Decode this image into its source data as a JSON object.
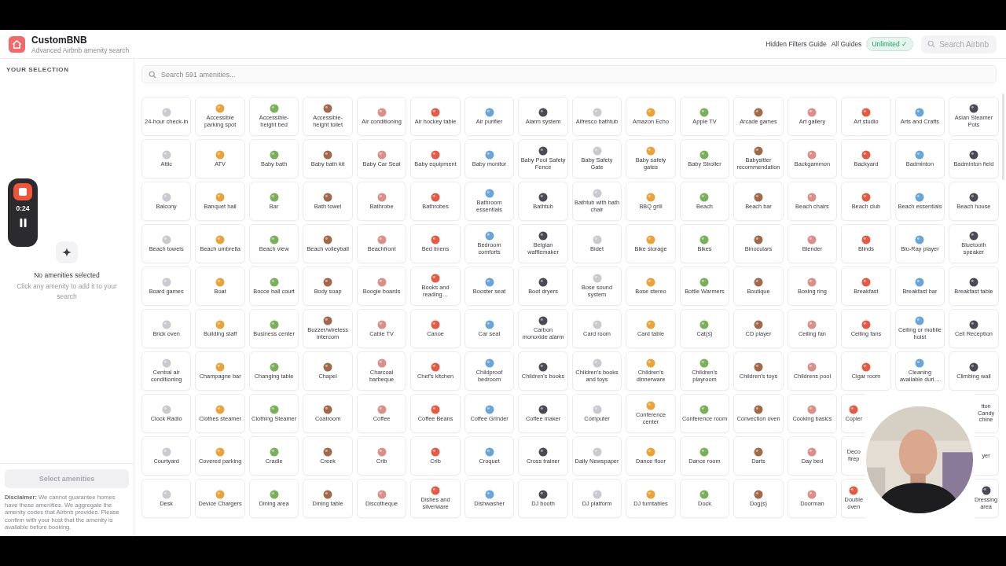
{
  "app": {
    "name": "CustomBNB",
    "tagline": "Advanced Airbnb amenity search"
  },
  "nav": {
    "links": [
      "Hidden Filters Guide",
      "All Guides"
    ],
    "plan_badge": "Unlimited ✓",
    "search_button": "Search Airbnb"
  },
  "sidebar": {
    "heading": "YOUR SELECTION",
    "empty_title": "No amenities selected",
    "empty_hint": "Click any amenity to add it to your search",
    "select_button": {
      "label": "Select amenities",
      "disabled": true
    },
    "disclaimer": "**Disclaimer:** We cannot guarantee homes have these amenities. We aggregate the amenity codes that Airbnb provides. Please confirm with your host that the amenity is available before booking."
  },
  "recorder": {
    "time": "0:24"
  },
  "amenity_search": {
    "placeholder": "Search 591 amenities..."
  },
  "amenities": [
    {
      "label": "24-hour check-in",
      "kind": "full"
    },
    {
      "label": "Accessible parking spot",
      "kind": "full"
    },
    {
      "label": "Accessible-height bed",
      "kind": "full"
    },
    {
      "label": "Accessible-height toilet",
      "kind": "full"
    },
    {
      "label": "Air conditioning",
      "kind": "full"
    },
    {
      "label": "Air hockey table",
      "kind": "full"
    },
    {
      "label": "Air purifier",
      "kind": "full"
    },
    {
      "label": "Alarm system",
      "kind": "full"
    },
    {
      "label": "Alfresco bathtub",
      "kind": "full"
    },
    {
      "label": "Amazon Echo",
      "kind": "full"
    },
    {
      "label": "Apple TV",
      "kind": "full"
    },
    {
      "label": "Arcade games",
      "kind": "full"
    },
    {
      "label": "Art gallery",
      "kind": "full"
    },
    {
      "label": "Art studio",
      "kind": "full"
    },
    {
      "label": "Arts and Crafts",
      "kind": "full"
    },
    {
      "label": "Asian Steamer Pots",
      "kind": "full"
    },
    {
      "label": "Attic",
      "kind": "full"
    },
    {
      "label": "ATV",
      "kind": "full"
    },
    {
      "label": "Baby bath",
      "kind": "full"
    },
    {
      "label": "Baby bath kit",
      "kind": "full"
    },
    {
      "label": "Baby Car Seat",
      "kind": "full"
    },
    {
      "label": "Baby equipment",
      "kind": "full"
    },
    {
      "label": "Baby monitor",
      "kind": "full"
    },
    {
      "label": "Baby Pool Safety Fence",
      "kind": "full"
    },
    {
      "label": "Baby Safety Gate",
      "kind": "full"
    },
    {
      "label": "Baby safety gates",
      "kind": "full"
    },
    {
      "label": "Baby Stroller",
      "kind": "full"
    },
    {
      "label": "Babysitter recommendation",
      "kind": "full"
    },
    {
      "label": "Backgammon",
      "kind": "full"
    },
    {
      "label": "Backyard",
      "kind": "full"
    },
    {
      "label": "Badminton",
      "kind": "full"
    },
    {
      "label": "Badminton field",
      "kind": "full"
    },
    {
      "label": "Balcony",
      "kind": "full"
    },
    {
      "label": "Banquet hall",
      "kind": "full"
    },
    {
      "label": "Bar",
      "kind": "full"
    },
    {
      "label": "Bath towel",
      "kind": "full"
    },
    {
      "label": "Bathrobe",
      "kind": "full"
    },
    {
      "label": "Bathrobes",
      "kind": "full"
    },
    {
      "label": "Bathroom essentials",
      "kind": "full"
    },
    {
      "label": "Bathtub",
      "kind": "full"
    },
    {
      "label": "Bathtub with bath chair",
      "kind": "full"
    },
    {
      "label": "BBQ grill",
      "kind": "full"
    },
    {
      "label": "Beach",
      "kind": "full"
    },
    {
      "label": "Beach bar",
      "kind": "full"
    },
    {
      "label": "Beach chairs",
      "kind": "full"
    },
    {
      "label": "Beach club",
      "kind": "full"
    },
    {
      "label": "Beach essentials",
      "kind": "full"
    },
    {
      "label": "Beach house",
      "kind": "full"
    },
    {
      "label": "Beach towels",
      "kind": "full"
    },
    {
      "label": "Beach umbrella",
      "kind": "full"
    },
    {
      "label": "Beach view",
      "kind": "full"
    },
    {
      "label": "Beach volleyball",
      "kind": "full"
    },
    {
      "label": "Beachfront",
      "kind": "full"
    },
    {
      "label": "Bed linens",
      "kind": "full"
    },
    {
      "label": "Bedroom comforts",
      "kind": "full"
    },
    {
      "label": "Belgian wafflemaker",
      "kind": "full"
    },
    {
      "label": "Bidet",
      "kind": "full"
    },
    {
      "label": "Bike storage",
      "kind": "full"
    },
    {
      "label": "Bikes",
      "kind": "full"
    },
    {
      "label": "Binoculars",
      "kind": "full"
    },
    {
      "label": "Blender",
      "kind": "full"
    },
    {
      "label": "Blinds",
      "kind": "full"
    },
    {
      "label": "Blu-Ray player",
      "kind": "full"
    },
    {
      "label": "Bluetooth speaker",
      "kind": "full"
    },
    {
      "label": "Board games",
      "kind": "full"
    },
    {
      "label": "Boat",
      "kind": "full"
    },
    {
      "label": "Bocce ball court",
      "kind": "full"
    },
    {
      "label": "Body soap",
      "kind": "full"
    },
    {
      "label": "Boogie boards",
      "kind": "full"
    },
    {
      "label": "Books and reading…",
      "kind": "full"
    },
    {
      "label": "Booster seat",
      "kind": "full"
    },
    {
      "label": "Boot dryers",
      "kind": "full"
    },
    {
      "label": "Bose sound system",
      "kind": "full"
    },
    {
      "label": "Bose stereo",
      "kind": "full"
    },
    {
      "label": "Bottle Warmers",
      "kind": "full"
    },
    {
      "label": "Boutique",
      "kind": "full"
    },
    {
      "label": "Boxing ring",
      "kind": "full"
    },
    {
      "label": "Breakfast",
      "kind": "full"
    },
    {
      "label": "Breakfast bar",
      "kind": "full"
    },
    {
      "label": "Breakfast table",
      "kind": "full"
    },
    {
      "label": "Brick oven",
      "kind": "full"
    },
    {
      "label": "Building staff",
      "kind": "full"
    },
    {
      "label": "Business center",
      "kind": "full"
    },
    {
      "label": "Buzzer/wireless intercom",
      "kind": "full"
    },
    {
      "label": "Cable TV",
      "kind": "full"
    },
    {
      "label": "Canoe",
      "kind": "full"
    },
    {
      "label": "Car seat",
      "kind": "full"
    },
    {
      "label": "Carbon monoxide alarm",
      "kind": "full"
    },
    {
      "label": "Card room",
      "kind": "full"
    },
    {
      "label": "Card table",
      "kind": "full"
    },
    {
      "label": "Cat(s)",
      "kind": "full"
    },
    {
      "label": "CD player",
      "kind": "full"
    },
    {
      "label": "Ceiling fan",
      "kind": "full"
    },
    {
      "label": "Ceiling fans",
      "kind": "full"
    },
    {
      "label": "Ceiling or mobile hoist",
      "kind": "full"
    },
    {
      "label": "Cell Reception",
      "kind": "full"
    },
    {
      "label": "Central air conditioning",
      "kind": "full"
    },
    {
      "label": "Champagne bar",
      "kind": "full"
    },
    {
      "label": "Changing table",
      "kind": "full"
    },
    {
      "label": "Chapel",
      "kind": "full"
    },
    {
      "label": "Charcoal barbeque",
      "kind": "full"
    },
    {
      "label": "Chef's kitchen",
      "kind": "full"
    },
    {
      "label": "Childproof bedroom",
      "kind": "full"
    },
    {
      "label": "Children's books",
      "kind": "full"
    },
    {
      "label": "Children's books and toys",
      "kind": "full"
    },
    {
      "label": "Children's dinnerware",
      "kind": "full"
    },
    {
      "label": "Children's playroom",
      "kind": "full"
    },
    {
      "label": "Children's toys",
      "kind": "full"
    },
    {
      "label": "Childrens pool",
      "kind": "full"
    },
    {
      "label": "Cigar room",
      "kind": "full"
    },
    {
      "label": "Cleaning available duri…",
      "kind": "full"
    },
    {
      "label": "Climbing wall",
      "kind": "full"
    },
    {
      "label": "Clock Radio",
      "kind": "full"
    },
    {
      "label": "Clothes steamer",
      "kind": "full"
    },
    {
      "label": "Clothing Steamer",
      "kind": "full"
    },
    {
      "label": "Coatroom",
      "kind": "full"
    },
    {
      "label": "Coffee",
      "kind": "full"
    },
    {
      "label": "Coffee Beans",
      "kind": "full"
    },
    {
      "label": "Coffee Grinder",
      "kind": "full"
    },
    {
      "label": "Coffee maker",
      "kind": "full"
    },
    {
      "label": "Computer",
      "kind": "full"
    },
    {
      "label": "Conference center",
      "kind": "full"
    },
    {
      "label": "Conference room",
      "kind": "full"
    },
    {
      "label": "Convection oven",
      "kind": "full"
    },
    {
      "label": "Cooking basics",
      "kind": "full"
    },
    {
      "label": "Copier",
      "kind": "left-part"
    },
    {
      "kind": "covered"
    },
    {
      "label": "tton Candy\nchine",
      "kind": "right-part"
    },
    {
      "label": "Courtyard",
      "kind": "full"
    },
    {
      "label": "Covered parking",
      "kind": "full"
    },
    {
      "label": "Cradle",
      "kind": "full"
    },
    {
      "label": "Creek",
      "kind": "full"
    },
    {
      "label": "Crib",
      "kind": "full"
    },
    {
      "label": "Crib",
      "kind": "full"
    },
    {
      "label": "Croquet",
      "kind": "full"
    },
    {
      "label": "Cross trainer",
      "kind": "full"
    },
    {
      "label": "Daily Newspaper",
      "kind": "full"
    },
    {
      "label": "Dance floor",
      "kind": "full"
    },
    {
      "label": "Dance room",
      "kind": "full"
    },
    {
      "label": "Darts",
      "kind": "full"
    },
    {
      "label": "Day bed",
      "kind": "full"
    },
    {
      "label": "Deco\nfirep",
      "kind": "left-part"
    },
    {
      "kind": "covered"
    },
    {
      "label": "yer",
      "kind": "right-part"
    },
    {
      "label": "Desk",
      "kind": "full"
    },
    {
      "label": "Device Chargers",
      "kind": "full"
    },
    {
      "label": "Dining area",
      "kind": "full"
    },
    {
      "label": "Dining table",
      "kind": "full"
    },
    {
      "label": "Discotheque",
      "kind": "full"
    },
    {
      "label": "Dishes and silverware",
      "kind": "full"
    },
    {
      "label": "Dishwasher",
      "kind": "full"
    },
    {
      "label": "DJ booth",
      "kind": "full"
    },
    {
      "label": "DJ platform",
      "kind": "full"
    },
    {
      "label": "DJ turntables",
      "kind": "full"
    },
    {
      "label": "Dock",
      "kind": "full"
    },
    {
      "label": "Dog(s)",
      "kind": "full"
    },
    {
      "label": "Doorman",
      "kind": "full"
    },
    {
      "label": "Double oven",
      "kind": "left-part"
    },
    {
      "kind": "covered"
    },
    {
      "label": "Dressing area",
      "kind": "right-part"
    }
  ]
}
